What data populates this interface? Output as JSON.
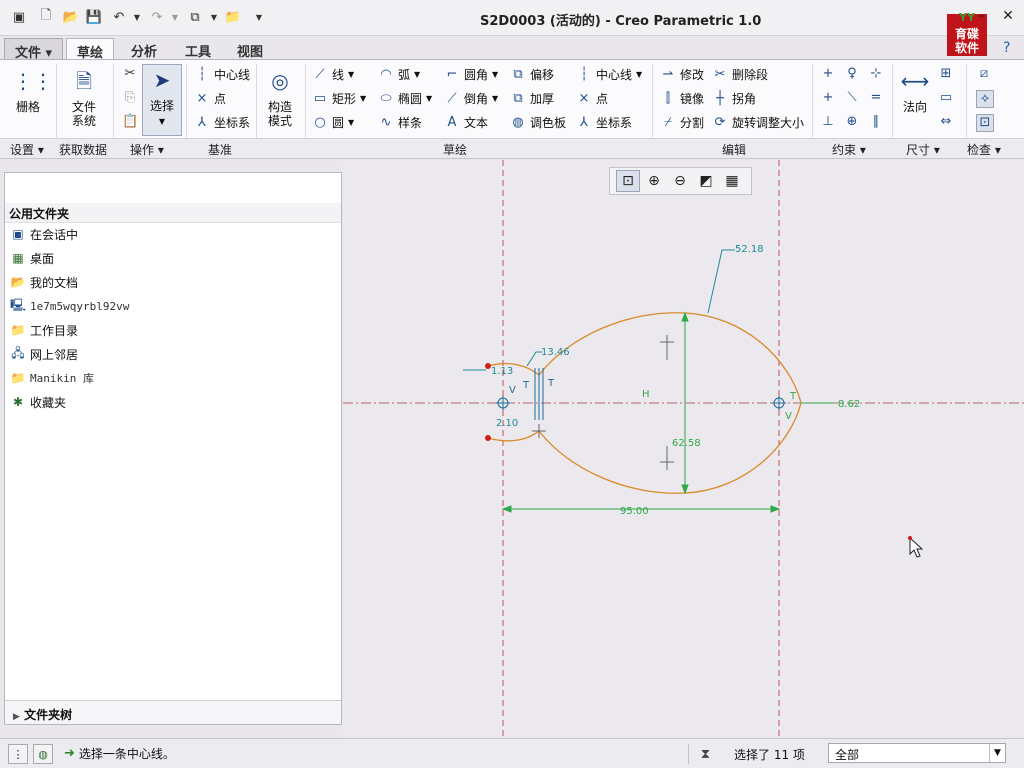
{
  "window": {
    "title": "S2D0003 (活动的) - Creo Parametric 1.0",
    "brand": {
      "hat": "YY",
      "line1": "育碟",
      "line2": "软件"
    }
  },
  "quick_access": [
    "window-icon",
    "new-icon",
    "open-icon",
    "save-icon",
    "undo-icon",
    "redo-icon",
    "windows-icon",
    "folder-icon",
    "customize-icon"
  ],
  "menu_tabs": [
    "文件",
    "草绘",
    "分析",
    "工具",
    "视图"
  ],
  "ribbon": {
    "grid": "栅格",
    "file_system": "文件\n系统",
    "select": "选择",
    "construct_mode": "构造\n模式",
    "datum": {
      "centerline": "中心线",
      "point": "点",
      "coord_sys": "坐标系"
    },
    "sketch": {
      "line": "线",
      "rect": "矩形",
      "circle": "圆",
      "arc": "弧",
      "ellipse": "椭圆",
      "spline": "样条",
      "fillet": "圆角",
      "chamfer": "倒角",
      "text": "文本",
      "offset": "偏移",
      "thicken": "加厚",
      "palette": "调色板",
      "centerline": "中心线",
      "point": "点",
      "coord_sys": "坐标系"
    },
    "edit": {
      "modify": "修改",
      "delete_seg": "删除段",
      "mirror": "镜像",
      "corner": "拐角",
      "divide": "分割",
      "rotate_resize": "旋转调整大小"
    },
    "dimension": {
      "normal": "法向"
    },
    "groups": {
      "setup": "设置",
      "get_data": "获取数据",
      "operations": "操作",
      "datum": "基准",
      "sketch": "草绘",
      "edit": "编辑",
      "constrain": "约束",
      "dimension": "尺寸",
      "inspect": "检查"
    }
  },
  "navigator": {
    "header": "公用文件夹",
    "items": [
      {
        "icon": "monitor-icon",
        "label": "在会话中"
      },
      {
        "icon": "desktop-icon",
        "label": "桌面"
      },
      {
        "icon": "documents-icon",
        "label": "我的文档"
      },
      {
        "icon": "computer-icon",
        "label": "1e7m5wqyrbl92vw"
      },
      {
        "icon": "working-dir-icon",
        "label": "工作目录"
      },
      {
        "icon": "network-icon",
        "label": "网上邻居"
      },
      {
        "icon": "manikin-icon",
        "label": "Manikin 库"
      },
      {
        "icon": "favorites-icon",
        "label": "收藏夹"
      }
    ],
    "folder_tree": "文件夹树"
  },
  "sketch_dims": {
    "d1": "52.18",
    "d2": "13.46",
    "d3": "1.13",
    "d4": "2.10",
    "d5": "62.58",
    "d6": "95.00",
    "d7": "8.62",
    "c_h": "H",
    "c_v1": "V",
    "c_v2": "V",
    "c_t1": "T",
    "c_t2": "T",
    "c_t3": "T"
  },
  "status": {
    "message": "选择一条中心线。",
    "selected": "选择了 11 项",
    "filter": "全部"
  }
}
